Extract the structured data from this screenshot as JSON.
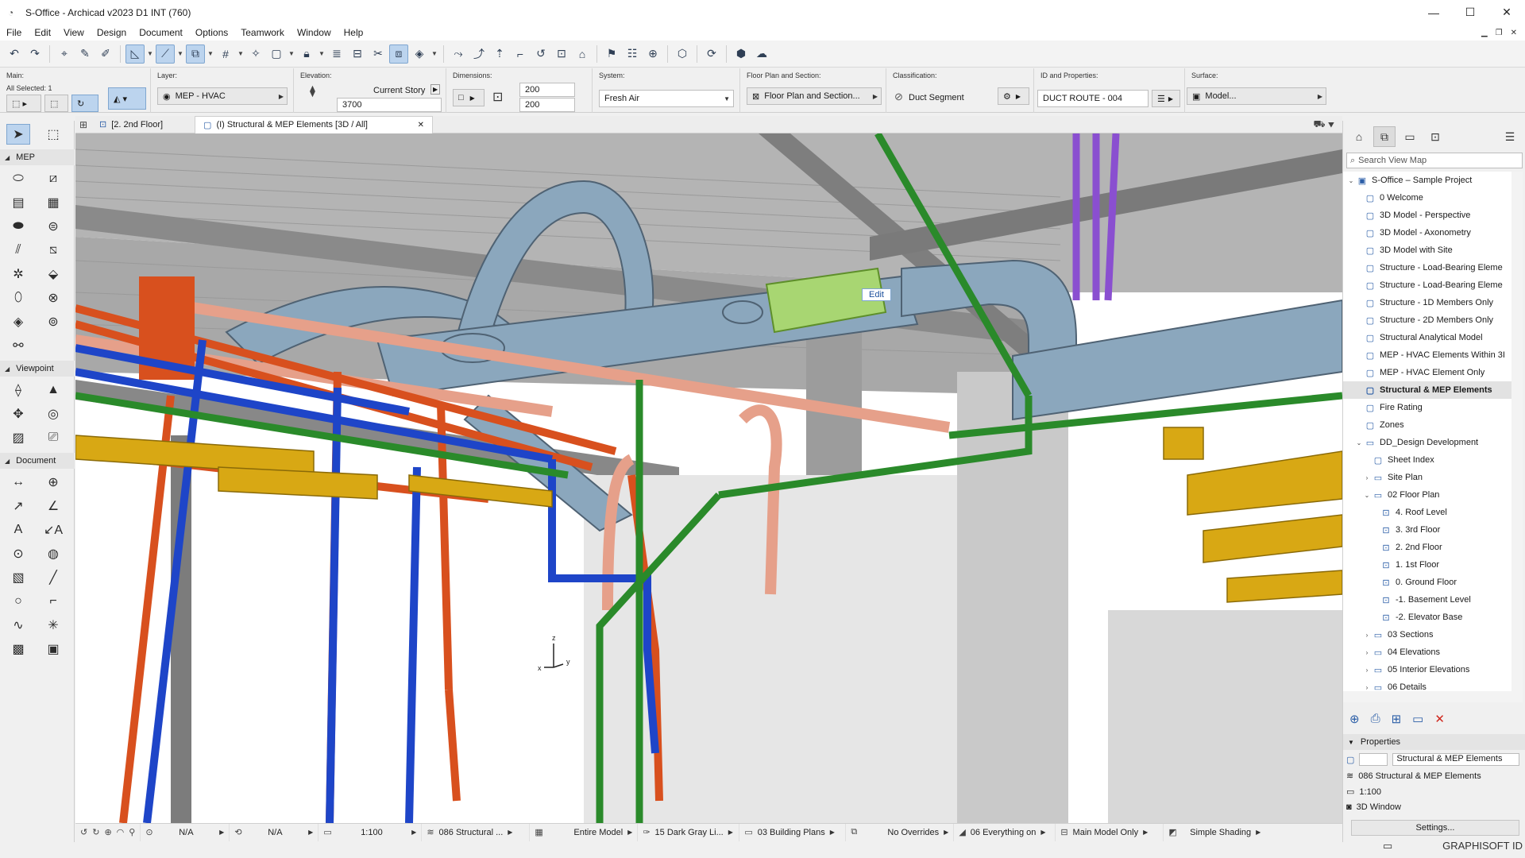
{
  "window": {
    "title": "S-Office - Archicad v2023 D1 INT (760)",
    "controls": [
      "—",
      "☐",
      "✕"
    ]
  },
  "menu": [
    "File",
    "Edit",
    "View",
    "Design",
    "Document",
    "Options",
    "Teamwork",
    "Window",
    "Help"
  ],
  "infobox": {
    "main_label": "Main:",
    "all_selected": "All Selected: 1",
    "layer_label": "Layer:",
    "layer_value": "MEP - HVAC",
    "elevation_label": "Elevation:",
    "elevation_story": "Current Story",
    "elevation_value": "3700",
    "dimensions_label": "Dimensions:",
    "dim_width": "200",
    "dim_height": "200",
    "system_label": "System:",
    "system_value": "Fresh Air",
    "floorplan_label": "Floor Plan and Section:",
    "floorplan_value": "Floor Plan and Section...",
    "classification_label": "Classification:",
    "classification_value": "Duct Segment",
    "id_label": "ID and Properties:",
    "id_value": "DUCT ROUTE - 004",
    "surface_label": "Surface:",
    "surface_value": "Model..."
  },
  "toolbox": {
    "sections": [
      "MEP",
      "Viewpoint",
      "Document"
    ]
  },
  "tabs": {
    "floor_tab": "[2. 2nd Floor]",
    "view3d_tab": "(I) Structural & MEP Elements [3D / All]"
  },
  "viewport": {
    "edit_label": "Edit",
    "axis_x": "x",
    "axis_y": "y",
    "axis_z": "z"
  },
  "statusbar": {
    "na1": "N/A",
    "na2": "N/A",
    "scale": "1:100",
    "layer_combo": "086 Structural ...",
    "model_view": "Entire Model",
    "pen_set": "15 Dark Gray Li...",
    "override_plans": "03 Building Plans",
    "overrides": "No Overrides",
    "renovation": "06 Everything on",
    "structure": "Main Model Only",
    "shading": "Simple Shading"
  },
  "navigator": {
    "search_placeholder": "Search View Map",
    "items": [
      {
        "label": "S-Office – Sample Project",
        "level": 0,
        "exp": "v",
        "icon": "project"
      },
      {
        "label": "0 Welcome",
        "level": 1,
        "exp": "",
        "icon": "view"
      },
      {
        "label": "3D Model - Perspective",
        "level": 1,
        "exp": "",
        "icon": "view"
      },
      {
        "label": "3D Model - Axonometry",
        "level": 1,
        "exp": "",
        "icon": "view"
      },
      {
        "label": "3D Model with Site",
        "level": 1,
        "exp": "",
        "icon": "view"
      },
      {
        "label": "Structure - Load-Bearing Eleme",
        "level": 1,
        "exp": "",
        "icon": "view"
      },
      {
        "label": "Structure - Load-Bearing Eleme",
        "level": 1,
        "exp": "",
        "icon": "view"
      },
      {
        "label": "Structure - 1D Members Only",
        "level": 1,
        "exp": "",
        "icon": "view"
      },
      {
        "label": "Structure - 2D Members Only",
        "level": 1,
        "exp": "",
        "icon": "view"
      },
      {
        "label": "Structural Analytical Model",
        "level": 1,
        "exp": "",
        "icon": "view"
      },
      {
        "label": "MEP - HVAC Elements Within 3I",
        "level": 1,
        "exp": "",
        "icon": "view"
      },
      {
        "label": "MEP - HVAC Element Only",
        "level": 1,
        "exp": "",
        "icon": "view"
      },
      {
        "label": "Structural & MEP Elements",
        "level": 1,
        "exp": "",
        "icon": "view",
        "selected": true
      },
      {
        "label": "Fire Rating",
        "level": 1,
        "exp": "",
        "icon": "view"
      },
      {
        "label": "Zones",
        "level": 1,
        "exp": "",
        "icon": "view"
      },
      {
        "label": "DD_Design Development",
        "level": 1,
        "exp": "v",
        "icon": "folder"
      },
      {
        "label": "Sheet Index",
        "level": 2,
        "exp": "",
        "icon": "view"
      },
      {
        "label": "Site Plan",
        "level": 2,
        "exp": ">",
        "icon": "folder"
      },
      {
        "label": "02 Floor Plan",
        "level": 2,
        "exp": "v",
        "icon": "folder"
      },
      {
        "label": "4. Roof Level",
        "level": 3,
        "exp": "",
        "icon": "plan"
      },
      {
        "label": "3. 3rd Floor",
        "level": 3,
        "exp": "",
        "icon": "plan"
      },
      {
        "label": "2. 2nd Floor",
        "level": 3,
        "exp": "",
        "icon": "plan"
      },
      {
        "label": "1. 1st Floor",
        "level": 3,
        "exp": "",
        "icon": "plan"
      },
      {
        "label": "0. Ground Floor",
        "level": 3,
        "exp": "",
        "icon": "plan"
      },
      {
        "label": "-1. Basement Level",
        "level": 3,
        "exp": "",
        "icon": "plan"
      },
      {
        "label": "-2. Elevator Base",
        "level": 3,
        "exp": "",
        "icon": "plan"
      },
      {
        "label": "03 Sections",
        "level": 2,
        "exp": ">",
        "icon": "folder"
      },
      {
        "label": "04 Elevations",
        "level": 2,
        "exp": ">",
        "icon": "folder"
      },
      {
        "label": "05 Interior Elevations",
        "level": 2,
        "exp": ">",
        "icon": "folder"
      },
      {
        "label": "06 Details",
        "level": 2,
        "exp": ">",
        "icon": "folder"
      }
    ],
    "properties_title": "Properties",
    "prop_name": "Structural & MEP Elements",
    "prop_layer": "086 Structural & MEP Elements",
    "prop_scale": "1:100",
    "prop_window": "3D Window",
    "settings_label": "Settings...",
    "brand": "GRAPHISOFT ID"
  },
  "colors": {
    "duct": "#8ba7bd",
    "red_pipe": "#d8501e",
    "blue_pipe": "#1e45c8",
    "green_pipe": "#2a8a2a",
    "purple_pipe": "#8a4fd0",
    "yellow_tray": "#d8a814",
    "salmon_pipe": "#e6a08a",
    "steel": "#8e8e8e",
    "selection": "#a8d672"
  }
}
